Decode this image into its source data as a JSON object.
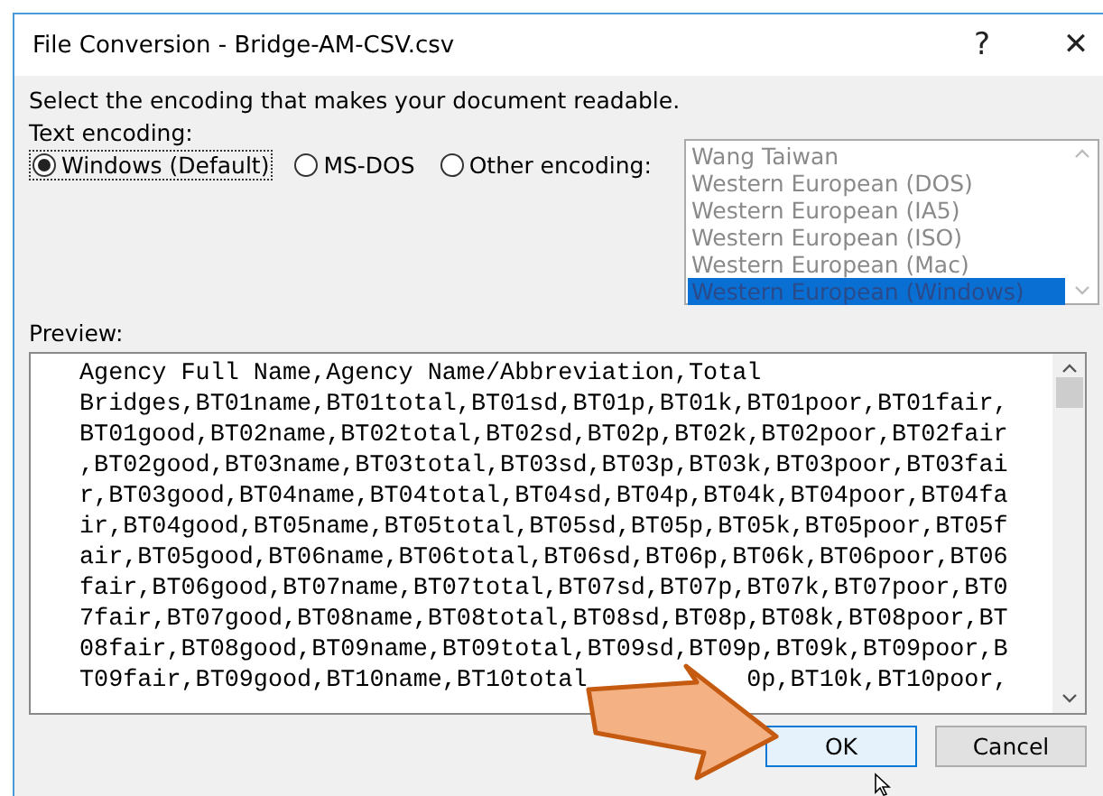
{
  "window": {
    "title": "File Conversion - Bridge-AM-CSV.csv",
    "help": "?",
    "close": "✕"
  },
  "instruction": "Select the encoding that makes your document readable.",
  "encoding_label": "Text encoding:",
  "radios": [
    {
      "label": "Windows (Default)",
      "selected": true,
      "focused": true
    },
    {
      "label": "MS-DOS",
      "selected": false,
      "focused": false
    },
    {
      "label": "Other encoding:",
      "selected": false,
      "focused": false
    }
  ],
  "encodings": [
    {
      "label": "Wang Taiwan",
      "selected": false
    },
    {
      "label": "Western European (DOS)",
      "selected": false
    },
    {
      "label": "Western European (IA5)",
      "selected": false
    },
    {
      "label": "Western European (ISO)",
      "selected": false
    },
    {
      "label": "Western European (Mac)",
      "selected": false
    },
    {
      "label": "Western European (Windows)",
      "selected": true
    }
  ],
  "preview_label": "Preview:",
  "preview_lines": [
    [
      "Agency Full Name,Agency Name/Abbreviation,Total"
    ],
    [
      "Bridges,BT01name,BT01total,BT01sd,BT01p,BT01k,BT01poor,BT01fair,"
    ],
    [
      "BT01good,BT02name,BT02total,BT02sd,BT02p,BT02k,BT02poor,BT02fair"
    ],
    [
      ",BT02good,BT03name,BT03total,BT03sd,BT03p,BT03k,BT03poor,BT03fai"
    ],
    [
      "r,BT03good,BT04name,BT04total,BT04sd,BT04p,BT04k,BT04poor,BT04fa"
    ],
    [
      "ir,BT04good,BT05name,BT05total,BT05sd,BT05p,BT05k,BT05poor,BT05f"
    ],
    [
      "air,BT05good,BT06name,BT06total,BT06sd,BT06p,BT06k,BT06poor,BT06"
    ],
    [
      "fair,BT06good,BT07name,BT07total,BT07sd,BT07p,BT07k,BT07poor,BT0"
    ],
    [
      "7fair,BT07good,BT08name,BT08total,BT08sd,BT08p,BT08k,BT08poor,BT"
    ],
    [
      "08fair,BT08good,BT09name,BT09total,BT09sd,BT09p,BT09k,BT09poor,B"
    ],
    [
      "T09fair,BT09good,BT10name,BT10total",
      "0p,BT10k,BT10poor,"
    ]
  ],
  "buttons": [
    {
      "label": "OK",
      "default": true
    },
    {
      "label": "Cancel",
      "default": false
    }
  ]
}
